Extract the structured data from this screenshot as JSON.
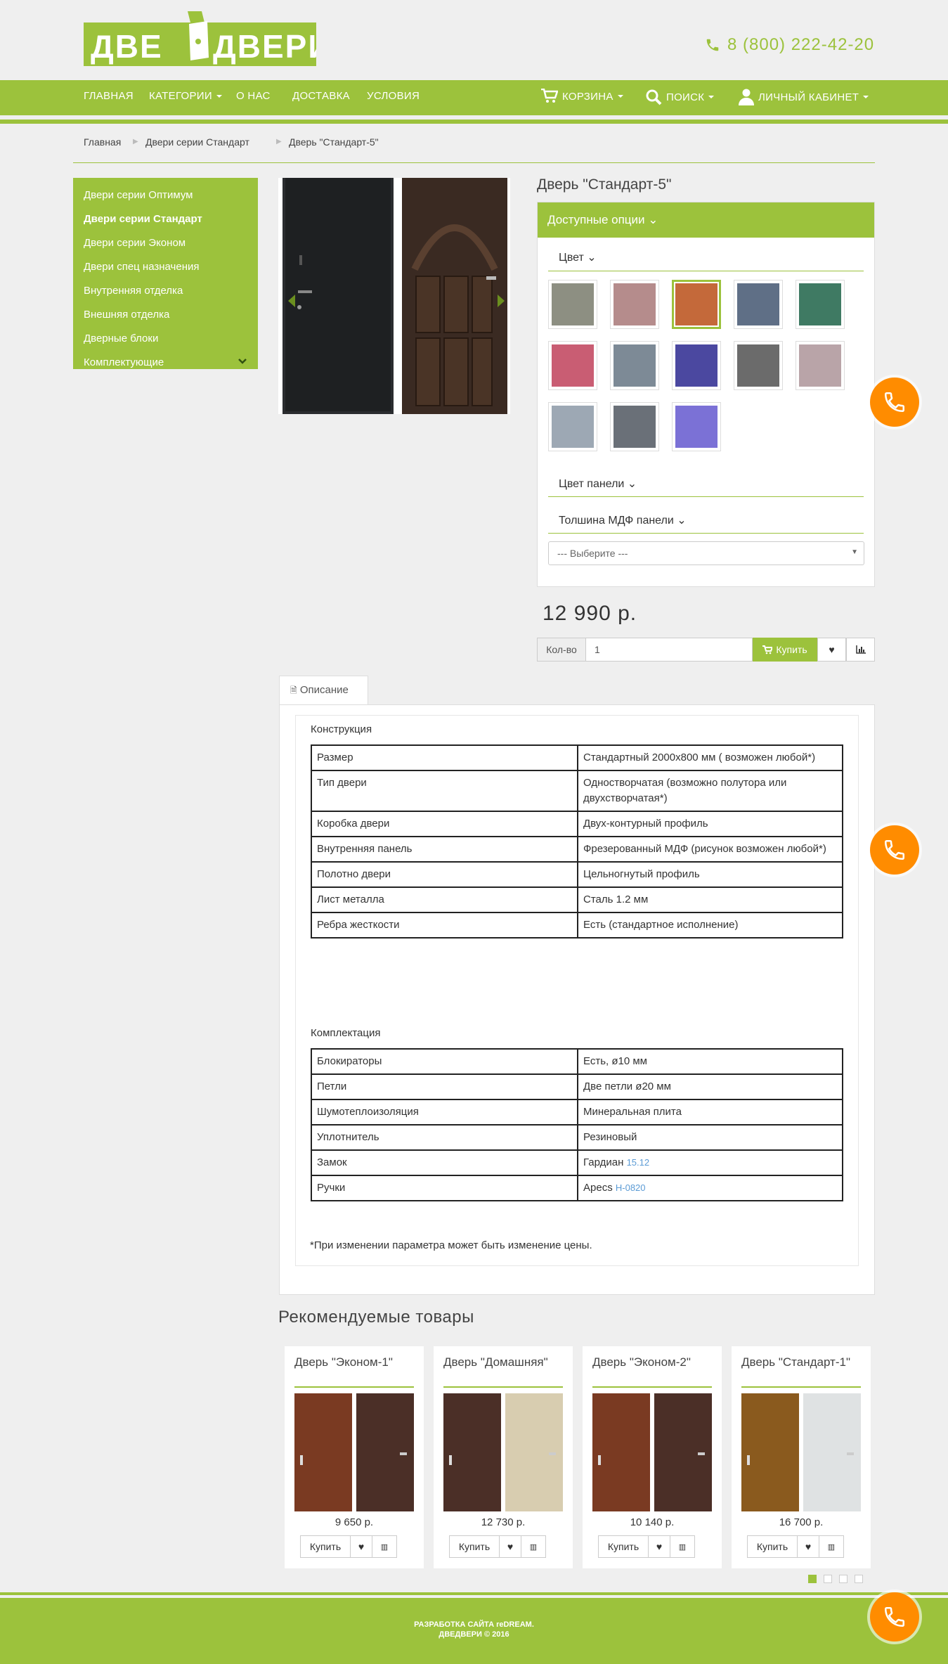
{
  "header": {
    "logo_text": "ДВЕ ДВЕРИ",
    "phone": "8 (800) 222-42-20"
  },
  "nav": {
    "items": [
      "ГЛАВНАЯ",
      "КАТЕГОРИИ",
      "О НАС",
      "ДОСТАВКА",
      "УСЛОВИЯ"
    ],
    "right": [
      "КОРЗИНА",
      "ПОИСК",
      "ЛИЧНЫЙ КАБИНЕТ"
    ]
  },
  "breadcrumb": [
    "Главная",
    "Двери серии Стандарт",
    "Дверь \"Стандарт-5\""
  ],
  "sidebar": {
    "items": [
      "Двери серии Оптимум",
      "Двери серии Стандарт",
      "Двери серии Эконом",
      "Двери спец назначения",
      "Внутренняя отделка",
      "Внешняя отделка",
      "Дверные блоки",
      "Комплектующие"
    ]
  },
  "product": {
    "title": "Дверь \"Стандарт-5\"",
    "options_title": "Доступные опции",
    "color_label": "Цвет",
    "panel_color_label": "Цвет панели",
    "mdf_label": "Толшина МДФ панели",
    "select_placeholder": "--- Выберите ---",
    "price": "12 990 р.",
    "qty_label": "Кол-во",
    "qty_value": "1",
    "buy_label": "Купить",
    "swatches": [
      "#8d8f82",
      "#b58c8c",
      "#c4693a",
      "#5f6f86",
      "#3f7a63",
      "#c95d73",
      "#7d8a96",
      "#4b48a0",
      "#6b6b6b",
      "#b9a4a8",
      "#9da8b4",
      "#6a7078",
      "#7b71d6"
    ]
  },
  "description": {
    "tab": "Описание",
    "section1": "Конструкция",
    "rows1": [
      [
        "Размер",
        "Стандартный 2000х800 мм ( возможен любой*)"
      ],
      [
        "Тип двери",
        "Одностворчатая (возможно полутора или двухстворчатая*)"
      ],
      [
        "Коробка двери",
        "Двух-контурный профиль"
      ],
      [
        "Внутренняя панель",
        "Фрезерованный МДФ (рисунок возможен любой*)"
      ],
      [
        "Полотно двери",
        "Цельногнутый профиль"
      ],
      [
        "Лист металла",
        "Сталь 1.2 мм"
      ],
      [
        "Ребра жесткости",
        "Есть (стандартное исполнение)"
      ]
    ],
    "section2": "Комплектация",
    "rows2": [
      [
        "Блокираторы",
        "Есть, ø10 мм"
      ],
      [
        "Петли",
        "Две петли ø20 мм"
      ],
      [
        "Шумотеплоизоляция",
        "Минеральная плита"
      ],
      [
        "Уплотнитель",
        "Резиновый"
      ]
    ],
    "lock_label": "Замок",
    "lock_value": "Гардиан",
    "lock_link": "15.12",
    "handle_label": "Ручки",
    "handle_value": "Apecs",
    "handle_link": "H-0820",
    "note": "*При изменении параметра может быть изменение цены."
  },
  "recommended": {
    "title": "Рекомендуемые товары",
    "buy": "Купить",
    "cards": [
      {
        "title": "Дверь \"Эконом-1\"",
        "price": "9 650 р."
      },
      {
        "title": "Дверь \"Домашняя\"",
        "price": "12 730 р."
      },
      {
        "title": "Дверь \"Эконом-2\"",
        "price": "10 140 р."
      },
      {
        "title": "Дверь \"Стандарт-1\"",
        "price": "16 700 р."
      }
    ]
  },
  "footer": {
    "line1": "РАЗРАБОТКА САЙТА reDREAM.",
    "line2": "ДВЕДВЕРИ © 2016"
  },
  "colors": {
    "accent": "#9cc23c",
    "call": "#ff8c00"
  }
}
